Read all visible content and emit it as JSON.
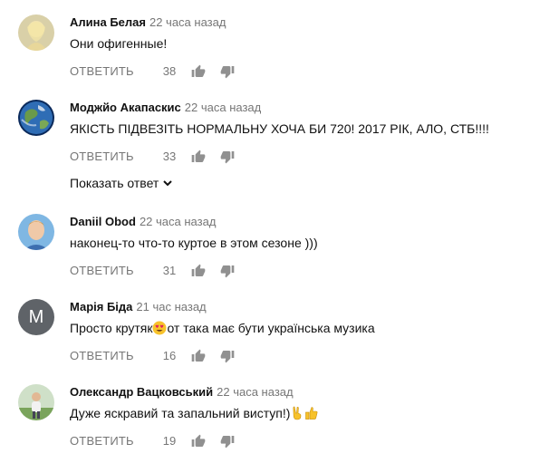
{
  "comments": [
    {
      "author": "Алина Белая",
      "time": "22 часа назад",
      "text": "Они офигенные!",
      "reply_label": "ОТВЕТИТЬ",
      "likes": "38",
      "avatar": "photo-avatar-blonde"
    },
    {
      "author": "Моджйо Акапаскис",
      "time": "22 часа назад",
      "text": "ЯКІСТЬ ПІДВЕЗІТЬ НОРМАЛЬНУ ХОЧА БИ 720! 2017 РІК, АЛО, СТБ!!!!",
      "reply_label": "ОТВЕТИТЬ",
      "likes": "33",
      "show_replies": "Показать ответ",
      "avatar": "earth-globe-avatar"
    },
    {
      "author": "Daniil Obod",
      "time": "22 часа назад",
      "text": "наконец-то что-то куртое в этом сезоне )))",
      "reply_label": "ОТВЕТИТЬ",
      "likes": "31",
      "avatar": "photo-avatar-man"
    },
    {
      "author": "Марія Біда",
      "time": "21 час назад",
      "text_before": "Просто крутяк",
      "text_after": "от така має бути українська музика",
      "emoji": "heart-eyes-emoji",
      "reply_label": "ОТВЕТИТЬ",
      "likes": "16",
      "avatar_letter": "M"
    },
    {
      "author": "Олександр Вацковський",
      "time": "22 часа назад",
      "text": "Дуже яскравий та запальний виступ!)",
      "emojis": [
        "victory-hand-emoji",
        "thumbs-up-emoji"
      ],
      "reply_label": "ОТВЕТИТЬ",
      "likes": "19",
      "avatar": "photo-avatar-outdoor"
    }
  ],
  "colors": {
    "meta_gray": "#767676",
    "icon_gray": "#909090",
    "letter_avatar_bg": "#5f6368"
  }
}
